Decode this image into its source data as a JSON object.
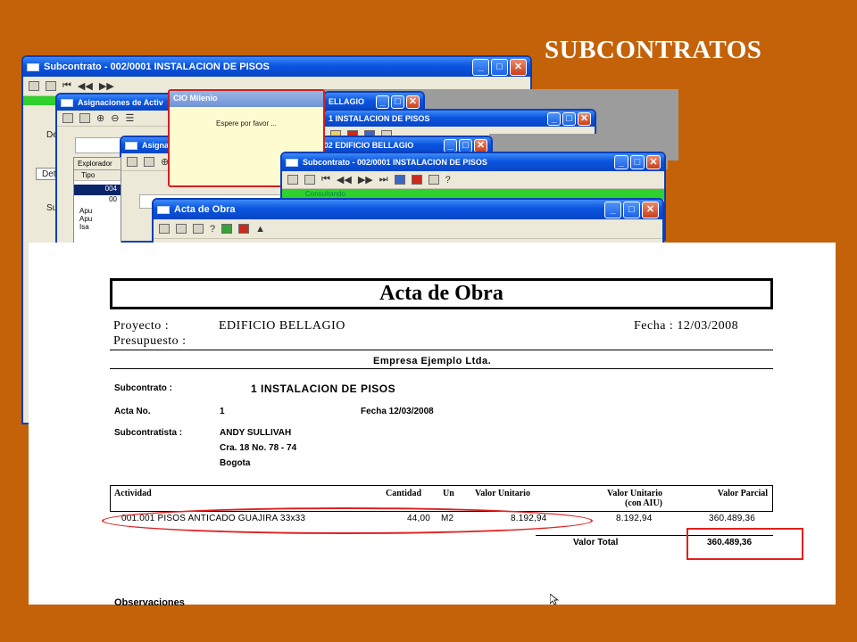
{
  "slide_title": "SUBCONTRATOS",
  "windows": {
    "w1_title": "Subcontrato - 002/0001 INSTALACION DE PISOS",
    "w2_title": "Asignaciones de Activ",
    "w2b_title": "ELLAGIO",
    "w3_title": "1 INSTALACION DE PISOS",
    "w4_title": "Asignaciones de Actividades Presupuestadas 002 EDIFICIO BELLAGIO",
    "w5_title": "Subcontrato - 002/0001 INSTALACION DE PISOS",
    "w6_title": "Acta de Obra",
    "dialog_title": "CIO Milenio",
    "dialog_msg": "Espere por favor ...",
    "explorer_tab": "Explorador",
    "tipo_header": "Tipo",
    "tipo_rows": [
      "Apu",
      "Apu",
      "Isa"
    ],
    "code_004": "004",
    "code_00": "00",
    "left_labels": [
      "Det",
      "Det",
      "Su"
    ],
    "green_status": "Consultando"
  },
  "report": {
    "title": "Acta de Obra",
    "proyecto_label": "Proyecto :",
    "proyecto_value": "EDIFICIO BELLAGIO",
    "presupuesto_label": "Presupuesto :",
    "fecha_label": "Fecha : 12/03/2008",
    "empresa": "Empresa Ejemplo Ltda.",
    "subcontrato_label": "Subcontrato :",
    "subcontrato_value": "1 INSTALACION DE PISOS",
    "acta_label": "Acta No.",
    "acta_value": "1",
    "fecha2": "Fecha 12/03/2008",
    "subcontratista_label": "Subcontratista :",
    "subcontratista_name": "ANDY SULLIVAH",
    "subcontratista_addr": "Cra. 18 No. 78 - 74",
    "subcontratista_city": "Bogota",
    "col_actividad": "Actividad",
    "col_cantidad": "Cantidad",
    "col_un": "Un",
    "col_valor_unitario": "Valor Unitario",
    "col_valor_aiu_1": "Valor Unitario",
    "col_valor_aiu_2": "(con AIU)",
    "col_valor_parcial": "Valor Parcial",
    "row_actividad": "001.001  PISOS ANTICADO GUAJIRA 33x33",
    "row_cantidad": "44,00",
    "row_un": "M2",
    "row_valor_unitario": "8.192,94",
    "row_valor_aiu": "8.192,94",
    "row_valor_parcial": "360.489,36",
    "valor_total_label": "Valor Total",
    "valor_total": "360.489,36",
    "observaciones": "Observaciones"
  }
}
